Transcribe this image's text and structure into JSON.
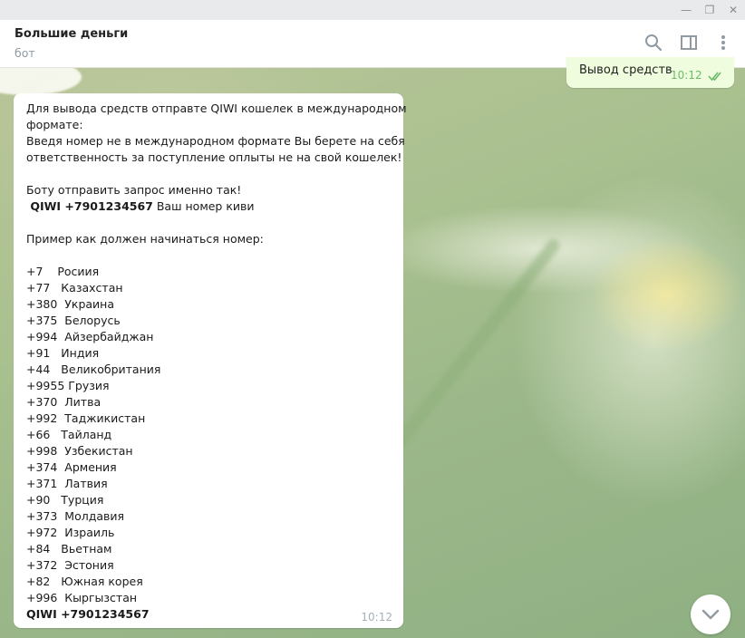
{
  "window": {
    "minimize_glyph": "—",
    "maximize_glyph": "❐",
    "close_glyph": "✕"
  },
  "header": {
    "title": "Большие деньги",
    "subtitle": "бот",
    "icons": [
      "search-icon",
      "sidebar-panel-icon",
      "more-vertical-icon"
    ]
  },
  "outgoing": {
    "text": "Вывод средств",
    "time": "10:12",
    "status": "read"
  },
  "incoming": {
    "time": "10:12",
    "intro": [
      "Для вывода средств отправте QIWI кошелек в международном",
      "формате:",
      "Введя номер не в международном формате Вы берете на себя",
      "ответственность за поступление оплыты не на свой кошелек!",
      "",
      "Боту отправить запрос именно так!"
    ],
    "request_bold": " QIWI +7901234567",
    "request_rest": " Ваш номер киви",
    "example_header": "Пример как должен начинаться номер:",
    "countries": [
      "+7    Росиия",
      "+77   Казахстан",
      "+380  Украина",
      "+375  Белорусь",
      "+994  Айзербайджан",
      "+91   Индия",
      "+44   Великобритания",
      "+9955 Грузия",
      "+370  Литва",
      "+992  Таджикистан",
      "+66   Тайланд",
      "+998  Узбекистан",
      "+374  Армения",
      "+371  Латвия",
      "+90   Турция",
      "+373  Молдавия",
      "+972  Израиль",
      "+84   Вьетнам",
      "+372  Эстония",
      "+82   Южная корея",
      "+996  Кыргызстан"
    ],
    "footer_bold": "QIWI +7901234567"
  },
  "colors": {
    "outgoing_bubble": "#effdde",
    "check_green": "#6dbb6a"
  }
}
